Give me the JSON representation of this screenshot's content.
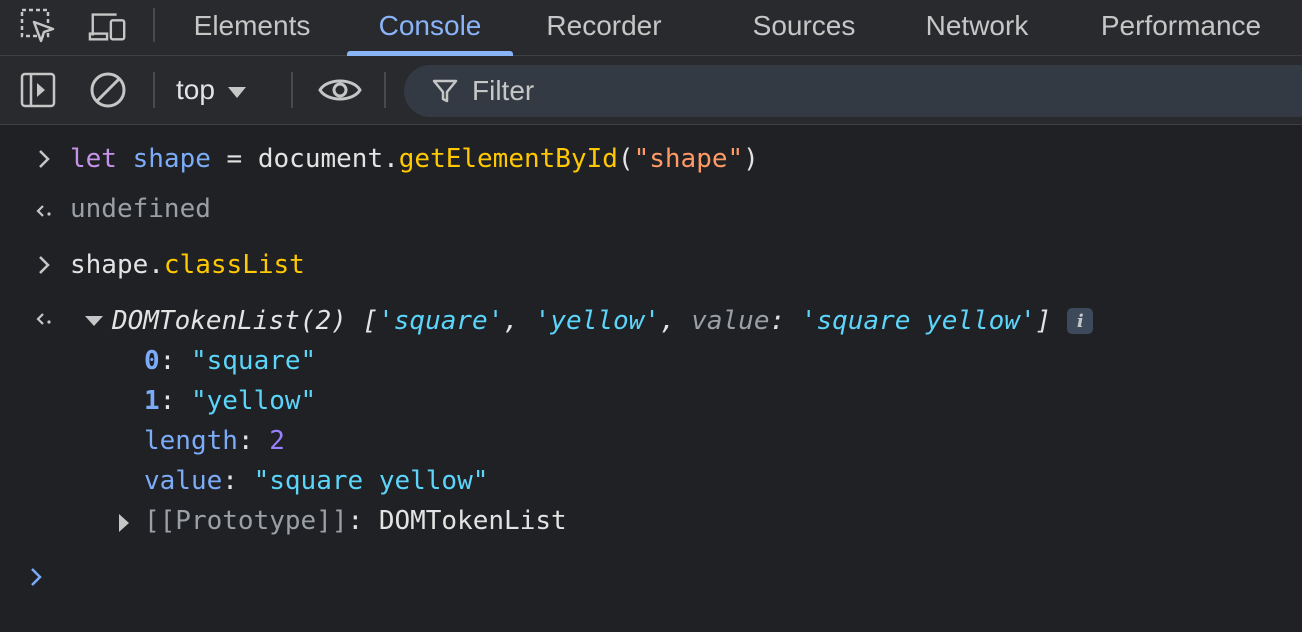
{
  "tabs": [
    {
      "label": "Elements"
    },
    {
      "label": "Console"
    },
    {
      "label": "Recorder"
    },
    {
      "label": "Sources"
    },
    {
      "label": "Network"
    },
    {
      "label": "Performance"
    }
  ],
  "active_tab": "Console",
  "toolbar": {
    "context": "top",
    "filter_placeholder": "Filter"
  },
  "console": {
    "input1": {
      "let": "let",
      "name": "shape",
      "eq": " = ",
      "doc": "document.",
      "fn": "getElementById",
      "lp": "(",
      "arg": "\"shape\"",
      "rp": ")"
    },
    "output1": "undefined",
    "input2": {
      "obj": "shape.",
      "prop": "classList"
    },
    "output2": {
      "type": "DOMTokenList(2)",
      "open": " [",
      "s1": "'square'",
      "c1": ", ",
      "s2": "'yellow'",
      "c2": ", ",
      "vkey": "value",
      "colon": ": ",
      "vval": "'square yellow'",
      "close": "]",
      "info": "i"
    },
    "props": [
      {
        "key": "0",
        "sep": ": ",
        "value": "\"square\""
      },
      {
        "key": "1",
        "sep": ": ",
        "value": "\"yellow\""
      },
      {
        "key": "length",
        "sep": ": ",
        "value": "2"
      },
      {
        "key": "value",
        "sep": ": ",
        "value": "\"square yellow\""
      }
    ],
    "prototype": {
      "key": "[[Prototype]]",
      "sep": ": ",
      "value": "DOMTokenList"
    }
  },
  "colors": {
    "accent": "#8ab4f8",
    "background": "#202124",
    "toolbar": "#282a2d"
  }
}
